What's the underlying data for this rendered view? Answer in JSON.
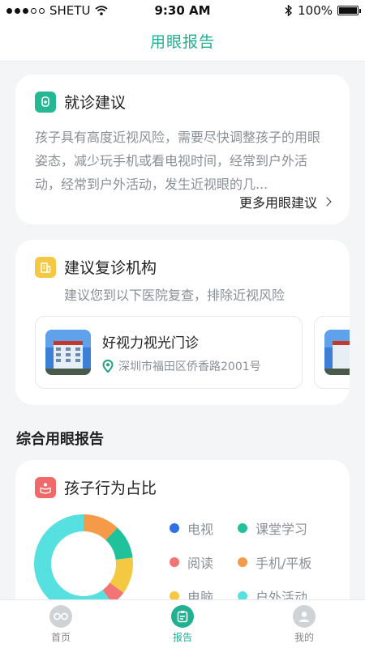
{
  "status_bar": {
    "carrier": "SHETU",
    "time": "9:30 AM",
    "battery_text": "100%",
    "battery_level": 1.0
  },
  "nav": {
    "title": "用眼报告"
  },
  "advice": {
    "title": "就诊建议",
    "text": "孩子具有高度近视风险，需要尽快调整孩子的用眼姿态，减少玩手机或看电视时间，经常到户外活动，经常到户外活动，发生近视眼的几...",
    "more_label": "更多用眼建议"
  },
  "revisit": {
    "title": "建议复诊机构",
    "subtitle": "建议您到以下医院复查，排除近视风险",
    "hospitals": [
      {
        "name": "好视力视光门诊",
        "address": "深圳市福田区侨香路2001号"
      },
      {
        "name": "",
        "address": ""
      }
    ]
  },
  "report": {
    "section_title": "综合用眼报告",
    "behavior": {
      "title": "孩子行为占比",
      "legend": [
        {
          "label": "电视",
          "color": "#2f6fe8"
        },
        {
          "label": "课堂学习",
          "color": "#1fc29a"
        },
        {
          "label": "阅读",
          "color": "#f27474"
        },
        {
          "label": "手机/平板",
          "color": "#f59a48"
        },
        {
          "label": "电脑",
          "color": "#f5c842"
        },
        {
          "label": "户外活动",
          "color": "#56e0e0"
        }
      ]
    }
  },
  "chart_data": {
    "type": "pie",
    "title": "",
    "categories": [
      "手机/平板",
      "课堂学习",
      "电脑",
      "阅读",
      "户外活动"
    ],
    "values": [
      12,
      11,
      12,
      5,
      60
    ],
    "colors": [
      "#f59a48",
      "#1fc29a",
      "#f5c842",
      "#f27474",
      "#56e0e0"
    ]
  },
  "tabs": [
    {
      "label": "首页",
      "icon": "glasses-icon",
      "active": false
    },
    {
      "label": "报告",
      "icon": "report-icon",
      "active": true
    },
    {
      "label": "我的",
      "icon": "user-icon",
      "active": false
    }
  ]
}
